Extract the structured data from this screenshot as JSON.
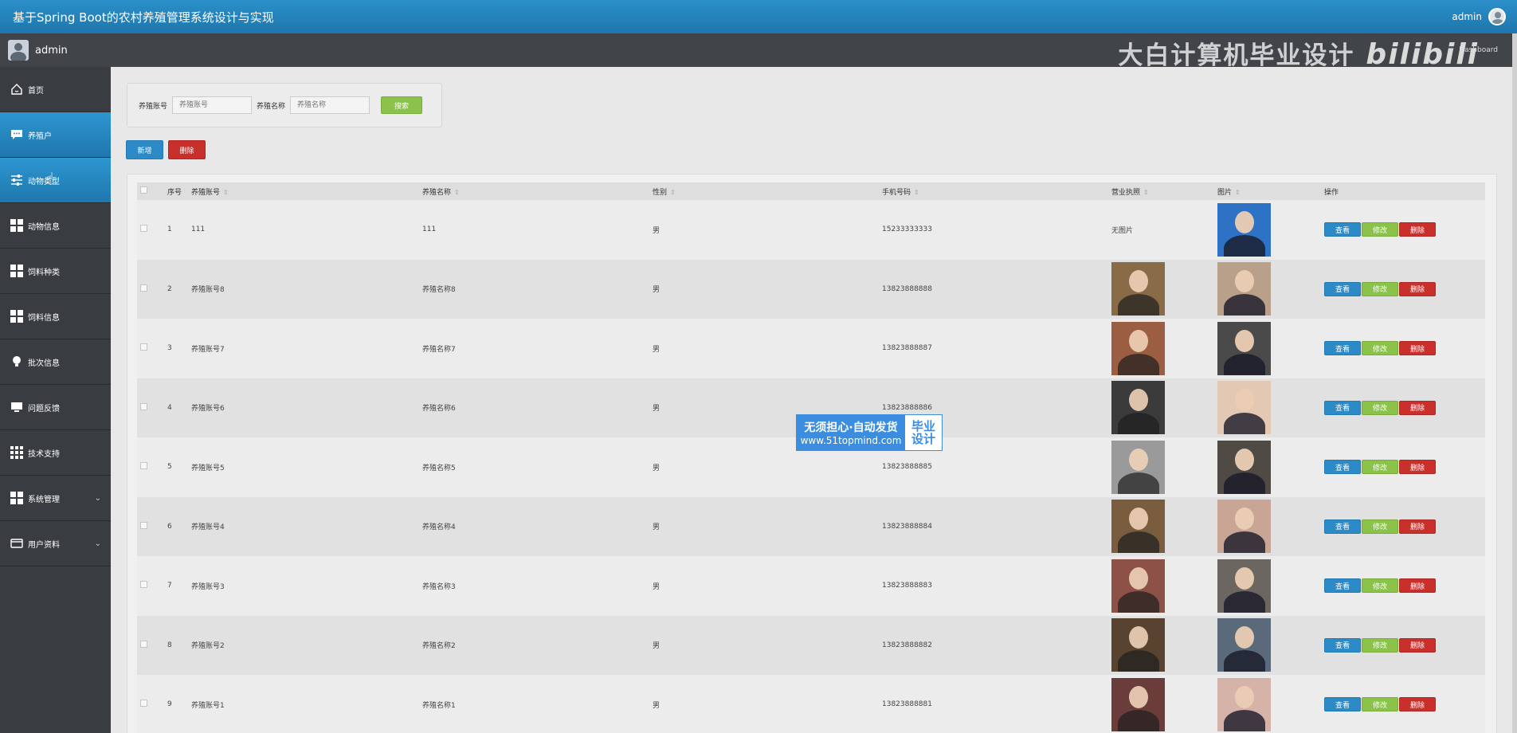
{
  "header": {
    "title": "基于Spring Boot的农村养殖管理系统设计与实现",
    "user": "admin"
  },
  "subbar": {
    "user": "admin",
    "watermark": "大白计算机毕业设计",
    "watermark_brand": "bilibili",
    "dashboard_text": "Dashboard"
  },
  "sidebar": {
    "items": [
      {
        "label": "首页",
        "icon": "home-icon"
      },
      {
        "label": "养殖户",
        "icon": "chat-icon"
      },
      {
        "label": "动物类型",
        "icon": "sliders-icon"
      },
      {
        "label": "动物信息",
        "icon": "grid-icon"
      },
      {
        "label": "饲料种类",
        "icon": "grid-icon"
      },
      {
        "label": "饲料信息",
        "icon": "grid-icon"
      },
      {
        "label": "批次信息",
        "icon": "bulb-icon"
      },
      {
        "label": "问题反馈",
        "icon": "monitor-icon"
      },
      {
        "label": "技术支持",
        "icon": "grid9-icon"
      },
      {
        "label": "系统管理",
        "icon": "grid-icon"
      },
      {
        "label": "用户资料",
        "icon": "card-icon"
      }
    ]
  },
  "search": {
    "account_label": "养殖账号",
    "account_placeholder": "养殖账号",
    "name_label": "养殖名称",
    "name_placeholder": "养殖名称",
    "search_label": "搜索"
  },
  "actions": {
    "add_label": "新增",
    "delete_label": "删除"
  },
  "table": {
    "columns": [
      "序号",
      "养殖账号",
      "养殖名称",
      "性别",
      "手机号码",
      "营业执照",
      "图片",
      "操作"
    ],
    "no_image": "无图片",
    "view_label": "查看",
    "edit_label": "修改",
    "delete_label": "删除",
    "rows": [
      {
        "index": "1",
        "account": "111",
        "name": "111",
        "gender": "男",
        "phone": "15233333333",
        "license": null,
        "photo": "#2d72c4"
      },
      {
        "index": "2",
        "account": "养殖账号8",
        "name": "养殖名称8",
        "gender": "男",
        "phone": "13823888888",
        "license": "#8a6b47",
        "photo": "#b9a08a"
      },
      {
        "index": "3",
        "account": "养殖账号7",
        "name": "养殖名称7",
        "gender": "男",
        "phone": "13823888887",
        "license": "#9b5e43",
        "photo": "#4a4a4a"
      },
      {
        "index": "4",
        "account": "养殖账号6",
        "name": "养殖名称6",
        "gender": "男",
        "phone": "13823888886",
        "license": "#3b3b3b",
        "photo": "#e3c9b4"
      },
      {
        "index": "5",
        "account": "养殖账号5",
        "name": "养殖名称5",
        "gender": "男",
        "phone": "13823888885",
        "license": "#9a9a9a",
        "photo": "#4f4a44"
      },
      {
        "index": "6",
        "account": "养殖账号4",
        "name": "养殖名称4",
        "gender": "男",
        "phone": "13823888884",
        "license": "#7a5c3e",
        "photo": "#c8a594"
      },
      {
        "index": "7",
        "account": "养殖账号3",
        "name": "养殖名称3",
        "gender": "男",
        "phone": "13823888883",
        "license": "#8d5148",
        "photo": "#6c6660"
      },
      {
        "index": "8",
        "account": "养殖账号2",
        "name": "养殖名称2",
        "gender": "男",
        "phone": "13823888882",
        "license": "#574330",
        "photo": "#5a6a7a"
      },
      {
        "index": "9",
        "account": "养殖账号1",
        "name": "养殖名称1",
        "gender": "男",
        "phone": "13823888881",
        "license": "#6a3d3a",
        "photo": "#d6b3a8"
      }
    ]
  },
  "ad": {
    "line1": "无须担心·自动发货",
    "line2": "www.51topmind.com",
    "badge1": "毕业",
    "badge2": "设计"
  },
  "colors": {
    "header_blue": "#1f76ad",
    "sidebar_dark": "#393d41",
    "view_button": "#2c8ac7",
    "edit_button": "#8bc34a",
    "delete_button": "#c9302c"
  }
}
